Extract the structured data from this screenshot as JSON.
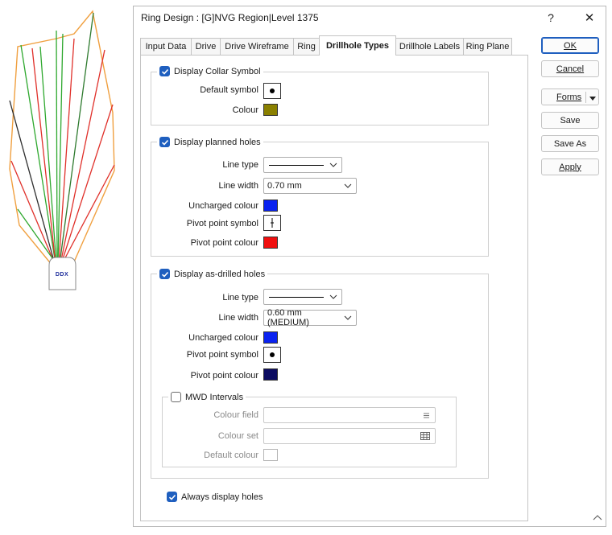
{
  "preview": {
    "label": "Ring preview",
    "collar_text": "DDX"
  },
  "dialog": {
    "title": "Ring Design : [G]NVG Region|Level 1375",
    "help_glyph": "?",
    "close_glyph": "✕"
  },
  "tabs": [
    {
      "label": "Input Data",
      "active": false
    },
    {
      "label": "Drive",
      "active": false
    },
    {
      "label": "Drive Wireframe",
      "active": false
    },
    {
      "label": "Ring",
      "active": false
    },
    {
      "label": "Drillhole Types",
      "active": true
    },
    {
      "label": "Drillhole Labels",
      "active": false
    },
    {
      "label": "Ring Plane",
      "active": false
    }
  ],
  "collar": {
    "checkbox_label": "Display Collar Symbol",
    "checked": true,
    "default_symbol_label": "Default symbol",
    "colour_label": "Colour",
    "colour": "#8a8000"
  },
  "planned": {
    "checkbox_label": "Display planned holes",
    "checked": true,
    "line_type_label": "Line type",
    "line_width_label": "Line width",
    "line_width_value": "0.70 mm",
    "uncharged_colour_label": "Uncharged colour",
    "uncharged_colour": "#0a22f0",
    "pivot_symbol_label": "Pivot point symbol",
    "pivot_colour_label": "Pivot point colour",
    "pivot_colour": "#f01010"
  },
  "asdrilled": {
    "checkbox_label": "Display as-drilled holes",
    "checked": true,
    "line_type_label": "Line type",
    "line_width_label": "Line width",
    "line_width_value": "0.60 mm (MEDIUM)",
    "uncharged_colour_label": "Uncharged colour",
    "uncharged_colour": "#0a22f0",
    "pivot_symbol_label": "Pivot point symbol",
    "pivot_colour_label": "Pivot point colour",
    "pivot_colour": "#0b0b60"
  },
  "mwd": {
    "checkbox_label": "MWD Intervals",
    "checked": false,
    "colour_field_label": "Colour field",
    "colour_field_value": "",
    "colour_set_label": "Colour set",
    "colour_set_value": "",
    "default_colour_label": "Default colour"
  },
  "always_display": {
    "checkbox_label": "Always display holes",
    "checked": true
  },
  "buttons": {
    "ok": "OK",
    "cancel": "Cancel",
    "forms": "Forms",
    "save": "Save",
    "save_as": "Save As",
    "apply": "Apply"
  },
  "colors": {
    "accent": "#1f5fbf",
    "preview_outline": "#f0a040",
    "preview_green": "#2ea82e",
    "preview_red": "#e0302a"
  }
}
